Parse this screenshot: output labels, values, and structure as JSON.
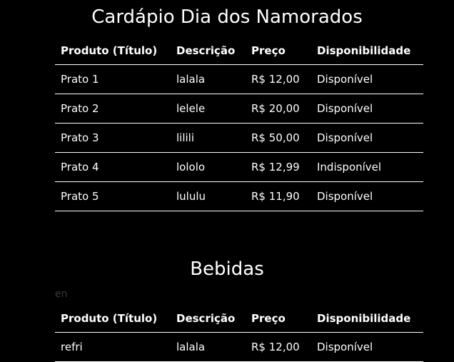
{
  "sections": [
    {
      "title": "Cardápio Dia dos Namorados",
      "headers": [
        "Produto (Título)",
        "Descrição",
        "Preço",
        "Disponibilidade"
      ],
      "rows": [
        [
          "Prato 1",
          "lalala",
          "R$ 12,00",
          "Disponível"
        ],
        [
          "Prato 2",
          "lelele",
          "R$ 20,00",
          "Disponível"
        ],
        [
          "Prato 3",
          "lilili",
          "R$ 50,00",
          "Disponível"
        ],
        [
          "Prato 4",
          "lololo",
          "R$ 12,99",
          "Indisponível"
        ],
        [
          "Prato 5",
          "lululu",
          "R$ 11,90",
          "Disponível"
        ]
      ]
    },
    {
      "title": "Bebidas",
      "stray_text": "en",
      "headers": [
        "Produto (Título)",
        "Descrição",
        "Preço",
        "Disponibilidade"
      ],
      "rows": [
        [
          "refri",
          "lalala",
          "R$ 12,00",
          "Disponível"
        ]
      ]
    }
  ]
}
